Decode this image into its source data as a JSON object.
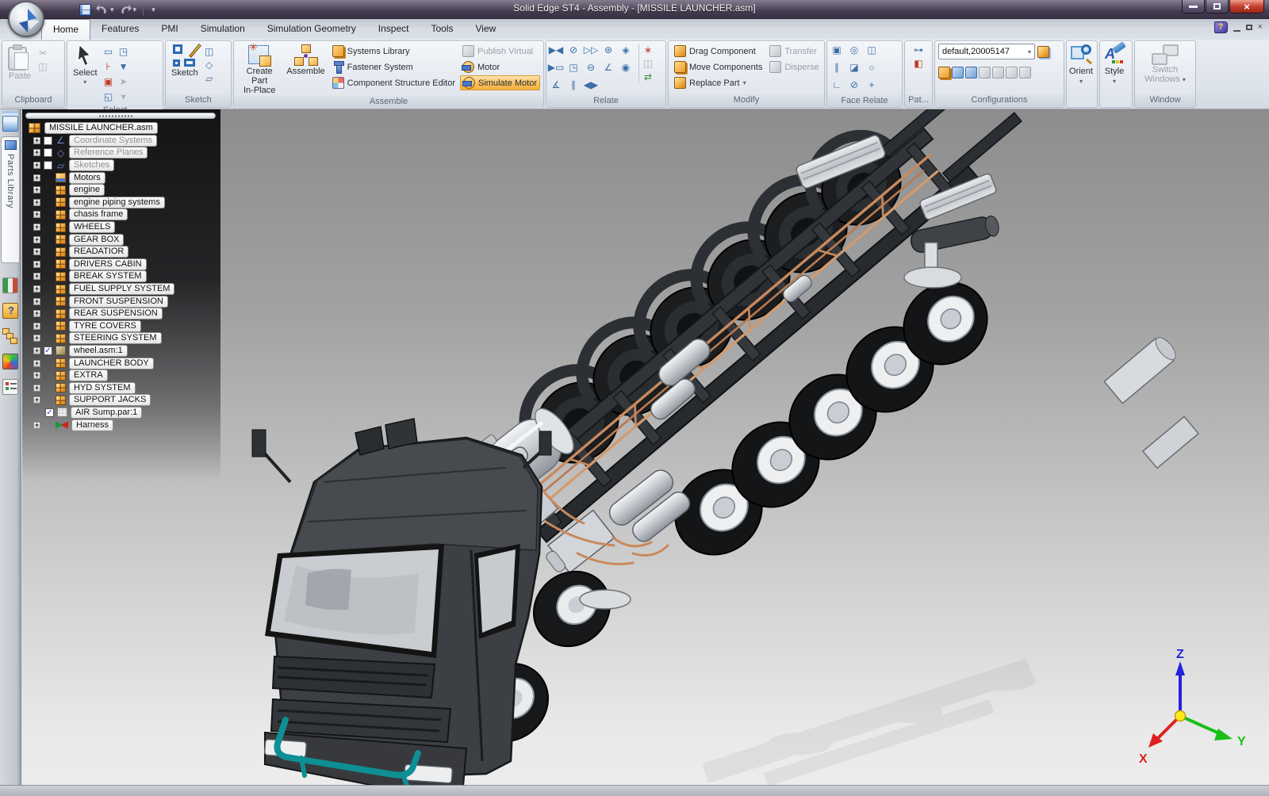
{
  "window": {
    "title": "Solid Edge ST4 - Assembly - [MISSILE LAUNCHER.asm]",
    "close_glyph": "×"
  },
  "quick_access": {
    "icons": [
      {
        "name": "save-icon"
      },
      {
        "name": "undo-icon"
      },
      {
        "name": "redo-icon"
      },
      {
        "name": "customize-quick-access-icon"
      }
    ]
  },
  "tabs": [
    {
      "label": "Home",
      "active": true
    },
    {
      "label": "Features",
      "active": false
    },
    {
      "label": "PMI",
      "active": false
    },
    {
      "label": "Simulation",
      "active": false
    },
    {
      "label": "Simulation Geometry",
      "active": false
    },
    {
      "label": "Inspect",
      "active": false
    },
    {
      "label": "Tools",
      "active": false
    },
    {
      "label": "View",
      "active": false
    }
  ],
  "ribbon": {
    "clipboard": {
      "label": "Clipboard",
      "paste": "Paste"
    },
    "select": {
      "label": "Select",
      "select": "Select",
      "minis": [
        {
          "name": "select-frame-icon",
          "g": "▭",
          "cls": ""
        },
        {
          "name": "select-box-icon",
          "g": "◳",
          "cls": ""
        },
        {
          "name": "select-pin-icon",
          "g": "⊦",
          "cls": "red"
        },
        {
          "name": "select-filter-icon",
          "g": "▼",
          "cls": ""
        },
        {
          "name": "select-priority-icon",
          "g": "▣",
          "cls": "red"
        },
        {
          "name": "select-locate-icon",
          "g": "➤",
          "cls": "dim"
        },
        {
          "name": "select-options-icon",
          "g": "◱",
          "cls": ""
        },
        {
          "name": "select-dropdown-icon",
          "g": "▾",
          "cls": "dim"
        }
      ]
    },
    "sketch_grp": {
      "label": "Sketch",
      "sketch": "Sketch",
      "minis": [
        {
          "name": "sketch-plane-icon",
          "g": "◫",
          "cls": ""
        },
        {
          "name": "sketch-3d-icon",
          "g": "◇",
          "cls": ""
        },
        {
          "name": "sketch-edit-icon",
          "g": "▱",
          "cls": ""
        }
      ]
    },
    "assemble": {
      "label": "Assemble",
      "create_part_line1": "Create Part",
      "create_part_line2": "In-Place",
      "assemble_btn": "Assemble",
      "col1": [
        {
          "label": "Systems Library",
          "icon": "systems-library-icon"
        },
        {
          "label": "Fastener System",
          "icon": "fastener-system-icon"
        },
        {
          "label": "Component Structure Editor",
          "icon": "component-structure-editor-icon"
        }
      ],
      "col2": [
        {
          "label": "Publish Virtual",
          "icon": "publish-virtual-icon",
          "disabled": true
        },
        {
          "label": "Motor",
          "icon": "motor-icon"
        },
        {
          "label": "Simulate Motor",
          "icon": "simulate-motor-icon",
          "highlight": true
        }
      ]
    },
    "relate": {
      "label": "Relate",
      "grid": [
        {
          "name": "mate-icon",
          "g": "▶◀"
        },
        {
          "name": "planar-align-icon",
          "g": "⊘"
        },
        {
          "name": "axial-align-icon",
          "g": "▷▷"
        },
        {
          "name": "gear-icon",
          "g": "⊛"
        },
        {
          "name": "center-plane-icon",
          "g": "◈"
        },
        {
          "name": "connect-icon",
          "g": "▶▭"
        },
        {
          "name": "insert-icon",
          "g": "◳"
        },
        {
          "name": "tangent-icon",
          "g": "⊖"
        },
        {
          "name": "match-coordinate-icon",
          "g": "∠"
        },
        {
          "name": "cam-icon",
          "g": "◉"
        },
        {
          "name": "angle-icon",
          "g": "∡"
        },
        {
          "name": "parallel-icon",
          "g": "∥"
        },
        {
          "name": "rigid-icon",
          "g": "◀▶"
        }
      ],
      "side": [
        {
          "name": "assemble-relate-icon",
          "g": "∗",
          "cls": "red"
        },
        {
          "name": "capture-fit-icon",
          "g": "◫",
          "cls": "dim"
        },
        {
          "name": "relationship-manager-icon",
          "g": "⇄",
          "cls": "green"
        }
      ]
    },
    "modify": {
      "label": "Modify",
      "col1": [
        {
          "label": "Drag Component",
          "icon": "drag-component-icon"
        },
        {
          "label": "Move Components",
          "icon": "move-components-icon"
        },
        {
          "label": "Replace Part",
          "icon": "replace-part-icon",
          "dropdown": true
        }
      ],
      "col2": [
        {
          "label": "Transfer",
          "icon": "transfer-icon",
          "disabled": true
        },
        {
          "label": "Disperse",
          "icon": "disperse-icon",
          "disabled": true
        }
      ]
    },
    "face_relate": {
      "label": "Face Relate",
      "grid": [
        {
          "name": "coincident-face-icon",
          "g": "▣"
        },
        {
          "name": "concentric-face-icon",
          "g": "◎"
        },
        {
          "name": "symmetric-face-icon",
          "g": "◫"
        },
        {
          "name": "parallel-face-icon",
          "g": "∥"
        },
        {
          "name": "offset-face-icon",
          "g": "◪"
        },
        {
          "name": "equal-radius-icon",
          "g": "○"
        },
        {
          "name": "perpendicular-face-icon",
          "g": "∟"
        },
        {
          "name": "tangent-face-icon",
          "g": "⊘"
        },
        {
          "name": "coplanar-axis-icon",
          "g": "+"
        }
      ]
    },
    "pattern": {
      "label": "Pat...",
      "icons": [
        {
          "name": "pattern-icon",
          "g": "⊶",
          "cls": ""
        },
        {
          "name": "mirror-icon",
          "g": "◧",
          "cls": "red"
        }
      ]
    },
    "configurations": {
      "label": "Configurations",
      "value": "default,20005147",
      "icons": [
        {
          "name": "apply-config-icon"
        },
        {
          "name": "display-config-icon"
        },
        {
          "name": "edit-config-icon"
        },
        {
          "name": "copy-config-icon"
        },
        {
          "name": "camera-icon"
        },
        {
          "name": "key-icon"
        },
        {
          "name": "zone-icon"
        }
      ]
    },
    "orient": {
      "label": "Orient"
    },
    "style": {
      "label": "Style"
    },
    "window_grp": {
      "label": "Window",
      "switch1": "Switch",
      "switch2": "Windows"
    }
  },
  "sidebar": {
    "parts_library": "Parts Library",
    "icons": [
      {
        "name": "pathfinder-layers-icon"
      },
      {
        "name": "animation-editor-icon"
      },
      {
        "name": "help-folder-icon"
      },
      {
        "name": "alternate-assemblies-icon"
      },
      {
        "name": "engineering-reference-icon"
      },
      {
        "name": "selection-list-icon"
      }
    ]
  },
  "pathfinder": {
    "root": "MISSILE LAUNCHER.asm",
    "items": [
      {
        "label": "Coordinate Systems",
        "icon": "coordinate-systems-icon",
        "glyph": "∠",
        "plus": true,
        "checkbox": "unchecked",
        "dim": true
      },
      {
        "label": "Reference Planes",
        "icon": "reference-planes-icon",
        "glyph": "◇",
        "plus": true,
        "checkbox": "unchecked",
        "dim": true
      },
      {
        "label": "Sketches",
        "icon": "sketches-icon",
        "glyph": "▱",
        "plus": true,
        "checkbox": "unchecked",
        "dim": true
      },
      {
        "label": "Motors",
        "icon": "motors-icon",
        "plus": true,
        "checkbox": "none",
        "dim": false
      },
      {
        "label": "engine",
        "icon": "assembly-icon",
        "plus": true,
        "checkbox": "none",
        "dim": false
      },
      {
        "label": "engine piping systems",
        "icon": "assembly-icon",
        "plus": true,
        "checkbox": "none",
        "dim": false
      },
      {
        "label": "chasis frame",
        "icon": "assembly-icon",
        "plus": true,
        "checkbox": "none",
        "dim": false
      },
      {
        "label": "WHEELS",
        "icon": "assembly-icon",
        "plus": true,
        "checkbox": "none",
        "dim": false
      },
      {
        "label": "GEAR BOX",
        "icon": "assembly-icon",
        "plus": true,
        "checkbox": "none",
        "dim": false
      },
      {
        "label": "READATIOR",
        "icon": "assembly-icon",
        "plus": true,
        "checkbox": "none",
        "dim": false
      },
      {
        "label": "DRIVERS CABIN",
        "icon": "assembly-icon",
        "plus": true,
        "checkbox": "none",
        "dim": false
      },
      {
        "label": "BREAK SYSTEM",
        "icon": "assembly-icon",
        "plus": true,
        "checkbox": "none",
        "dim": false
      },
      {
        "label": "FUEL SUPPLY SYSTEM",
        "icon": "assembly-icon",
        "plus": true,
        "checkbox": "none",
        "dim": false
      },
      {
        "label": "FRONT SUSPENSION",
        "icon": "assembly-icon",
        "plus": true,
        "checkbox": "none",
        "dim": false
      },
      {
        "label": "REAR SUSPENSION",
        "icon": "assembly-icon",
        "plus": true,
        "checkbox": "none",
        "dim": false
      },
      {
        "label": "TYRE COVERS",
        "icon": "assembly-icon",
        "plus": true,
        "checkbox": "none",
        "dim": false
      },
      {
        "label": "STEERING SYSTEM",
        "icon": "assembly-icon",
        "plus": true,
        "checkbox": "none",
        "dim": false
      },
      {
        "label": "wheel.asm:1",
        "icon": "subassembly-icon",
        "plus": true,
        "checkbox": "checked",
        "dim": false
      },
      {
        "label": "LAUNCHER BODY",
        "icon": "assembly-icon",
        "plus": true,
        "checkbox": "none",
        "dim": false
      },
      {
        "label": "EXTRA",
        "icon": "assembly-icon",
        "plus": true,
        "checkbox": "none",
        "dim": false
      },
      {
        "label": "HYD SYSTEM",
        "icon": "assembly-icon",
        "plus": true,
        "checkbox": "none",
        "dim": false
      },
      {
        "label": "SUPPORT JACKS",
        "icon": "assembly-icon",
        "plus": true,
        "checkbox": "none",
        "dim": false
      },
      {
        "label": "AIR Sump.par:1",
        "icon": "part-icon",
        "plus": false,
        "checkbox": "checked",
        "dim": false
      },
      {
        "label": "Harness",
        "icon": "harness-icon",
        "plus": true,
        "checkbox": "none",
        "dim": false
      }
    ]
  },
  "viewport": {
    "triad": {
      "x": "X",
      "y": "Y",
      "z": "Z"
    },
    "triad_colors": {
      "x": "#e02020",
      "y": "#18c018",
      "z": "#2020e0"
    }
  },
  "colors": {
    "highlight_orange": "#f9c25f",
    "titlebar_purple": "#4e4558",
    "pipe_copper": "#c8895c",
    "accent_teal": "#0d8f94"
  }
}
